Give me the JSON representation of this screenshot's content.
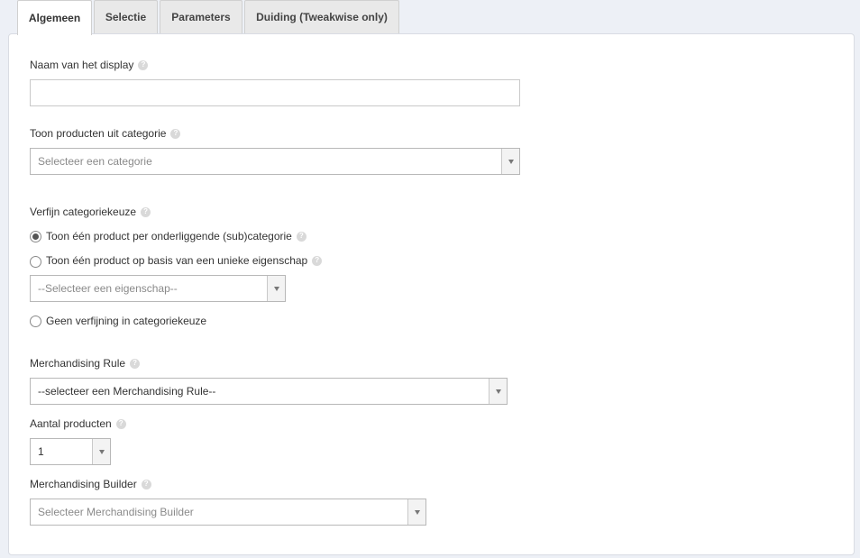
{
  "tabs": [
    {
      "label": "Algemeen",
      "active": true
    },
    {
      "label": "Selectie",
      "active": false
    },
    {
      "label": "Parameters",
      "active": false
    },
    {
      "label": "Duiding (Tweakwise only)",
      "active": false
    }
  ],
  "help_icon": "?",
  "form": {
    "display_name": {
      "label": "Naam van het display",
      "value": ""
    },
    "category": {
      "label": "Toon producten uit categorie",
      "value": "Selecteer een categorie"
    },
    "refine": {
      "label": "Verfijn categoriekeuze",
      "options": [
        {
          "label": "Toon één product per onderliggende (sub)categorie",
          "checked": true
        },
        {
          "label": "Toon één product op basis van een unieke eigenschap",
          "checked": false
        },
        {
          "label": "Geen verfijning in categoriekeuze",
          "checked": false
        }
      ],
      "property_select": "--Selecteer een eigenschap--"
    },
    "merch_rule": {
      "label": "Merchandising Rule",
      "value": "--selecteer een Merchandising Rule--"
    },
    "product_count": {
      "label": "Aantal producten",
      "value": "1"
    },
    "merch_builder": {
      "label": "Merchandising Builder",
      "value": "Selecteer Merchandising Builder"
    }
  },
  "colors": {
    "background": "#edf0f6",
    "panel": "#ffffff",
    "tab_inactive": "#e9e9e9"
  }
}
